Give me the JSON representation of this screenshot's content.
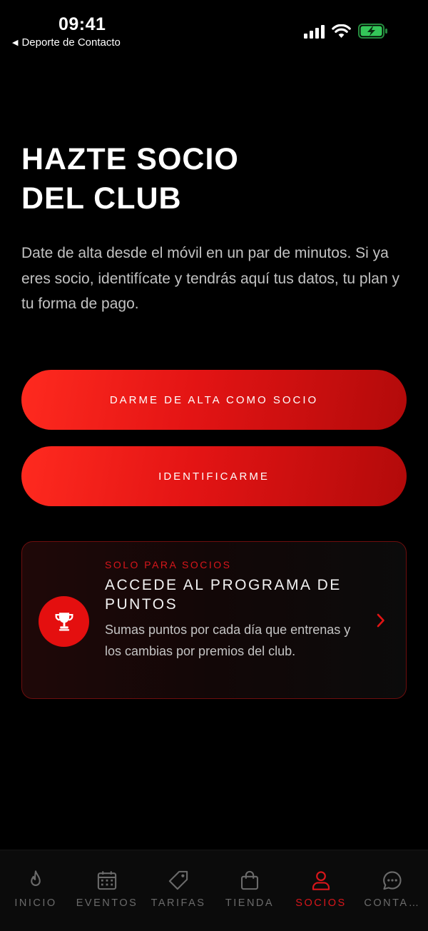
{
  "status_bar": {
    "time": "09:41",
    "back_label": "Deporte de Contacto",
    "icons": [
      "signal-icon",
      "wifi-icon",
      "battery-charging-icon"
    ],
    "battery_color": "#34c759"
  },
  "hero": {
    "title_line1": "HAZTE SOCIO",
    "title_line2": "DEL CLUB",
    "description": "Date de alta desde el móvil en un par de minutos. Si ya eres socio, identifícate y tendrás aquí tus datos, tu plan y tu forma de pago."
  },
  "actions": {
    "signup_label": "DARME DE ALTA COMO SOCIO",
    "login_label": "IDENTIFICARME"
  },
  "points_card": {
    "eyebrow": "SOLO PARA SOCIOS",
    "title": "ACCEDE AL PROGRAMA DE PUNTOS",
    "text": "Sumas puntos por cada día que entrenas y los cambias por premios del club.",
    "icon": "trophy-icon"
  },
  "tabs": [
    {
      "label": "INICIO",
      "icon": "flame-icon"
    },
    {
      "label": "EVENTOS",
      "icon": "calendar-icon"
    },
    {
      "label": "TARIFAS",
      "icon": "tag-icon"
    },
    {
      "label": "TIENDA",
      "icon": "shopping-bag-icon"
    },
    {
      "label": "SOCIOS",
      "icon": "user-icon",
      "active": true
    },
    {
      "label": "CONTA…",
      "icon": "chat-icon"
    }
  ],
  "colors": {
    "accent": "#e31414",
    "accent_text": "#d8161b",
    "background": "#000000",
    "inactive_tab": "#6b6b6b"
  }
}
